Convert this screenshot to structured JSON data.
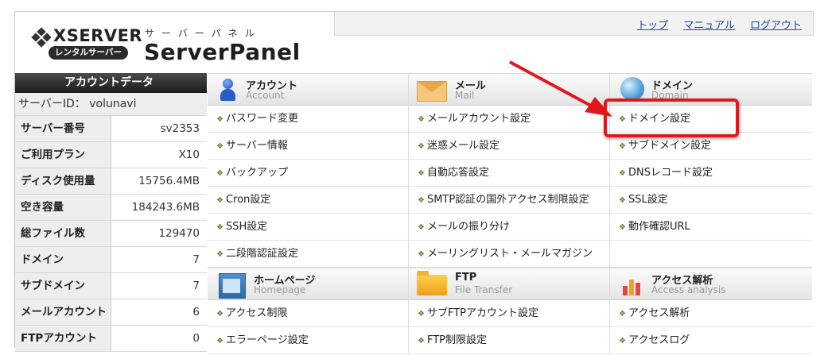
{
  "header": {
    "brand": "XSERVER",
    "brand_tagline": "レンタルサーバー",
    "panel_kana": "サーバーパネル",
    "panel_title": "ServerPanel",
    "links": [
      "トップ",
      "マニュアル",
      "ログアウト"
    ]
  },
  "account": {
    "heading": "アカウントデータ",
    "server_id": "サーバーID：  volunavi",
    "rows": [
      {
        "label": "サーバー番号",
        "value": "sv2353"
      },
      {
        "label": "ご利用プラン",
        "value": "X10"
      },
      {
        "label": "ディスク使用量",
        "value": "15756.4MB"
      },
      {
        "label": "空き容量",
        "value": "184243.6MB"
      },
      {
        "label": "総ファイル数",
        "value": "129470"
      },
      {
        "label": "ドメイン",
        "value": "7"
      },
      {
        "label": "サブドメイン",
        "value": "7"
      },
      {
        "label": "メールアカウント",
        "value": "6"
      },
      {
        "label": "FTPアカウント",
        "value": "0"
      }
    ]
  },
  "categories_top": [
    {
      "name": "アカウント",
      "sub": "Account",
      "icon": "account-icon"
    },
    {
      "name": "メール",
      "sub": "Mail",
      "icon": "mail-icon"
    },
    {
      "name": "ドメイン",
      "sub": "Domain",
      "icon": "globe-icon"
    }
  ],
  "items_top": [
    [
      "パスワード変更",
      "メールアカウント設定",
      "ドメイン設定"
    ],
    [
      "サーバー情報",
      "迷惑メール設定",
      "サブドメイン設定"
    ],
    [
      "バックアップ",
      "自動応答設定",
      "DNSレコード設定"
    ],
    [
      "Cron設定",
      "SMTP認証の国外アクセス制限設定",
      "SSL設定"
    ],
    [
      "SSH設定",
      "メールの振り分け",
      "動作確認URL"
    ],
    [
      "二段階認証設定",
      "メーリングリスト・メールマガジン",
      ""
    ]
  ],
  "categories_bottom": [
    {
      "name": "ホームページ",
      "sub": "Homepage",
      "icon": "homepage-icon"
    },
    {
      "name": "FTP",
      "sub": "File Transfer",
      "icon": "folder-icon"
    },
    {
      "name": "アクセス解析",
      "sub": "Access analysis",
      "icon": "chart-icon"
    }
  ],
  "items_bottom": [
    [
      "アクセス制限",
      "サブFTPアカウント設定",
      "アクセス解析"
    ],
    [
      "エラーページ設定",
      "FTP制限設定",
      "アクセスログ"
    ]
  ],
  "colors": {
    "highlight": "#e0181c",
    "link": "#1a4aa8"
  }
}
